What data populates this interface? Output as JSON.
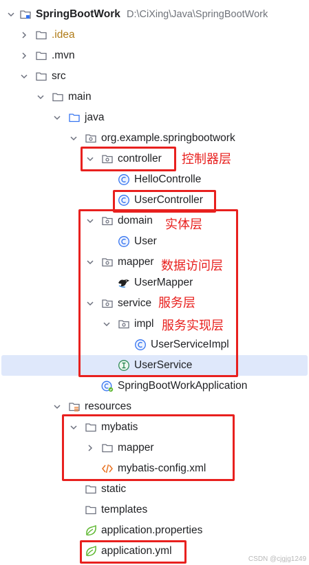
{
  "project": {
    "name": "SpringBootWork",
    "path": "D:\\CiXing\\Java\\SpringBootWork"
  },
  "tree": {
    "idea": ".idea",
    "mvn": ".mvn",
    "src": "src",
    "main": "main",
    "java": "java",
    "package": "org.example.springbootwork",
    "controller": "controller",
    "hello_controller": "HelloControlle",
    "user_controller": "UserController",
    "domain": "domain",
    "user": "User",
    "mapper": "mapper",
    "user_mapper": "UserMapper",
    "service": "service",
    "impl": "impl",
    "user_service_impl": "UserServiceImpl",
    "user_service": "UserService",
    "app_class": "SpringBootWorkApplication",
    "resources": "resources",
    "mybatis": "mybatis",
    "mybatis_mapper": "mapper",
    "mybatis_config": "mybatis-config.xml",
    "static": "static",
    "templates": "templates",
    "app_properties": "application.properties",
    "app_yml": "application.yml"
  },
  "annotations": {
    "controller_layer": "控制器层",
    "entity_layer": "实体层",
    "data_access_layer": "数据访问层",
    "service_layer": "服务层",
    "service_impl_layer": "服务实现层"
  },
  "watermark": "CSDN @cjgjg1249",
  "colors": {
    "annotation": "#e8201e",
    "selection": "#dfe8fb",
    "class_icon": "#3574f0",
    "interface_icon": "#2e8b57",
    "spring_icon": "#5fb832",
    "xml_icon": "#e8701e"
  }
}
